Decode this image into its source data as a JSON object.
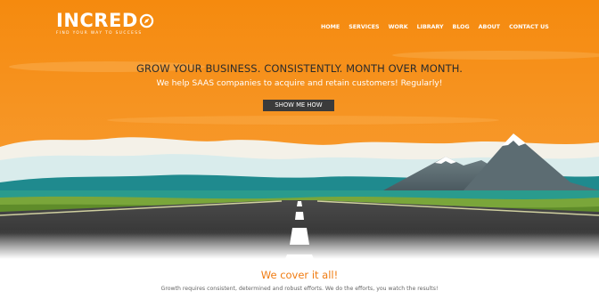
{
  "brand": {
    "name": "INCRED",
    "tagline": "FIND YOUR WAY TO SUCCESS"
  },
  "nav": {
    "items": [
      {
        "label": "HOME"
      },
      {
        "label": "SERVICES"
      },
      {
        "label": "WORK"
      },
      {
        "label": "LIBRARY"
      },
      {
        "label": "BLOG"
      },
      {
        "label": "ABOUT"
      },
      {
        "label": "CONTACT US"
      }
    ]
  },
  "hero": {
    "headline": "GROW YOUR BUSINESS. CONSISTENTLY. MONTH OVER MONTH.",
    "subheadline": "We help SAAS companies to acquire and retain customers! Regularly!",
    "cta_label": "SHOW ME HOW"
  },
  "section": {
    "title": "We cover it all!",
    "text": "Growth requires consistent, determined and robust efforts. We do the efforts, you watch the results!"
  },
  "colors": {
    "sky_top": "#f5880f",
    "sky_bottom": "#f7a030",
    "accent_orange": "#f07c12",
    "button_bg": "#3b3b3b"
  },
  "icons": {
    "logo_mark": "compass-o-icon"
  }
}
